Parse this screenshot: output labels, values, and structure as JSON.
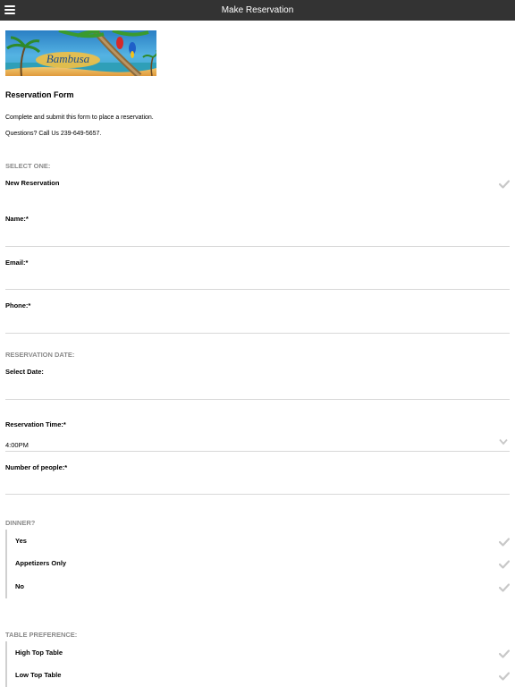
{
  "header": {
    "title": "Make Reservation",
    "menu_icon": "hamburger-menu-icon",
    "bar_color": "#333333"
  },
  "banner": {
    "logo_text": "Bambusa",
    "alt": "Bambusa logo banner"
  },
  "form": {
    "title": "Reservation Form",
    "intro": "Complete and submit this form to place a reservation.",
    "questions": "Questions? Call Us 239-649-5657."
  },
  "select_one": {
    "label": "SELECT ONE:",
    "option": "New Reservation"
  },
  "fields": {
    "name": "Name:*",
    "email": "Email:*",
    "phone": "Phone:*"
  },
  "reservation_date": {
    "label": "RESERVATION DATE:",
    "select_date": "Select Date:"
  },
  "reservation_time": {
    "label": "Reservation Time:*",
    "value": "4:00PM"
  },
  "people": {
    "label": "Number of people:*"
  },
  "dinner": {
    "label": "DINNER?",
    "options": [
      "Yes",
      "Appetizers Only",
      "No"
    ]
  },
  "table_preference": {
    "label": "TABLE PREFERENCE:",
    "options": [
      "High Top Table",
      "Low Top Table"
    ]
  },
  "colors": {
    "section_label": "#8a8a8a",
    "divider": "#d8d8d8",
    "check": "#c8c8c8"
  }
}
